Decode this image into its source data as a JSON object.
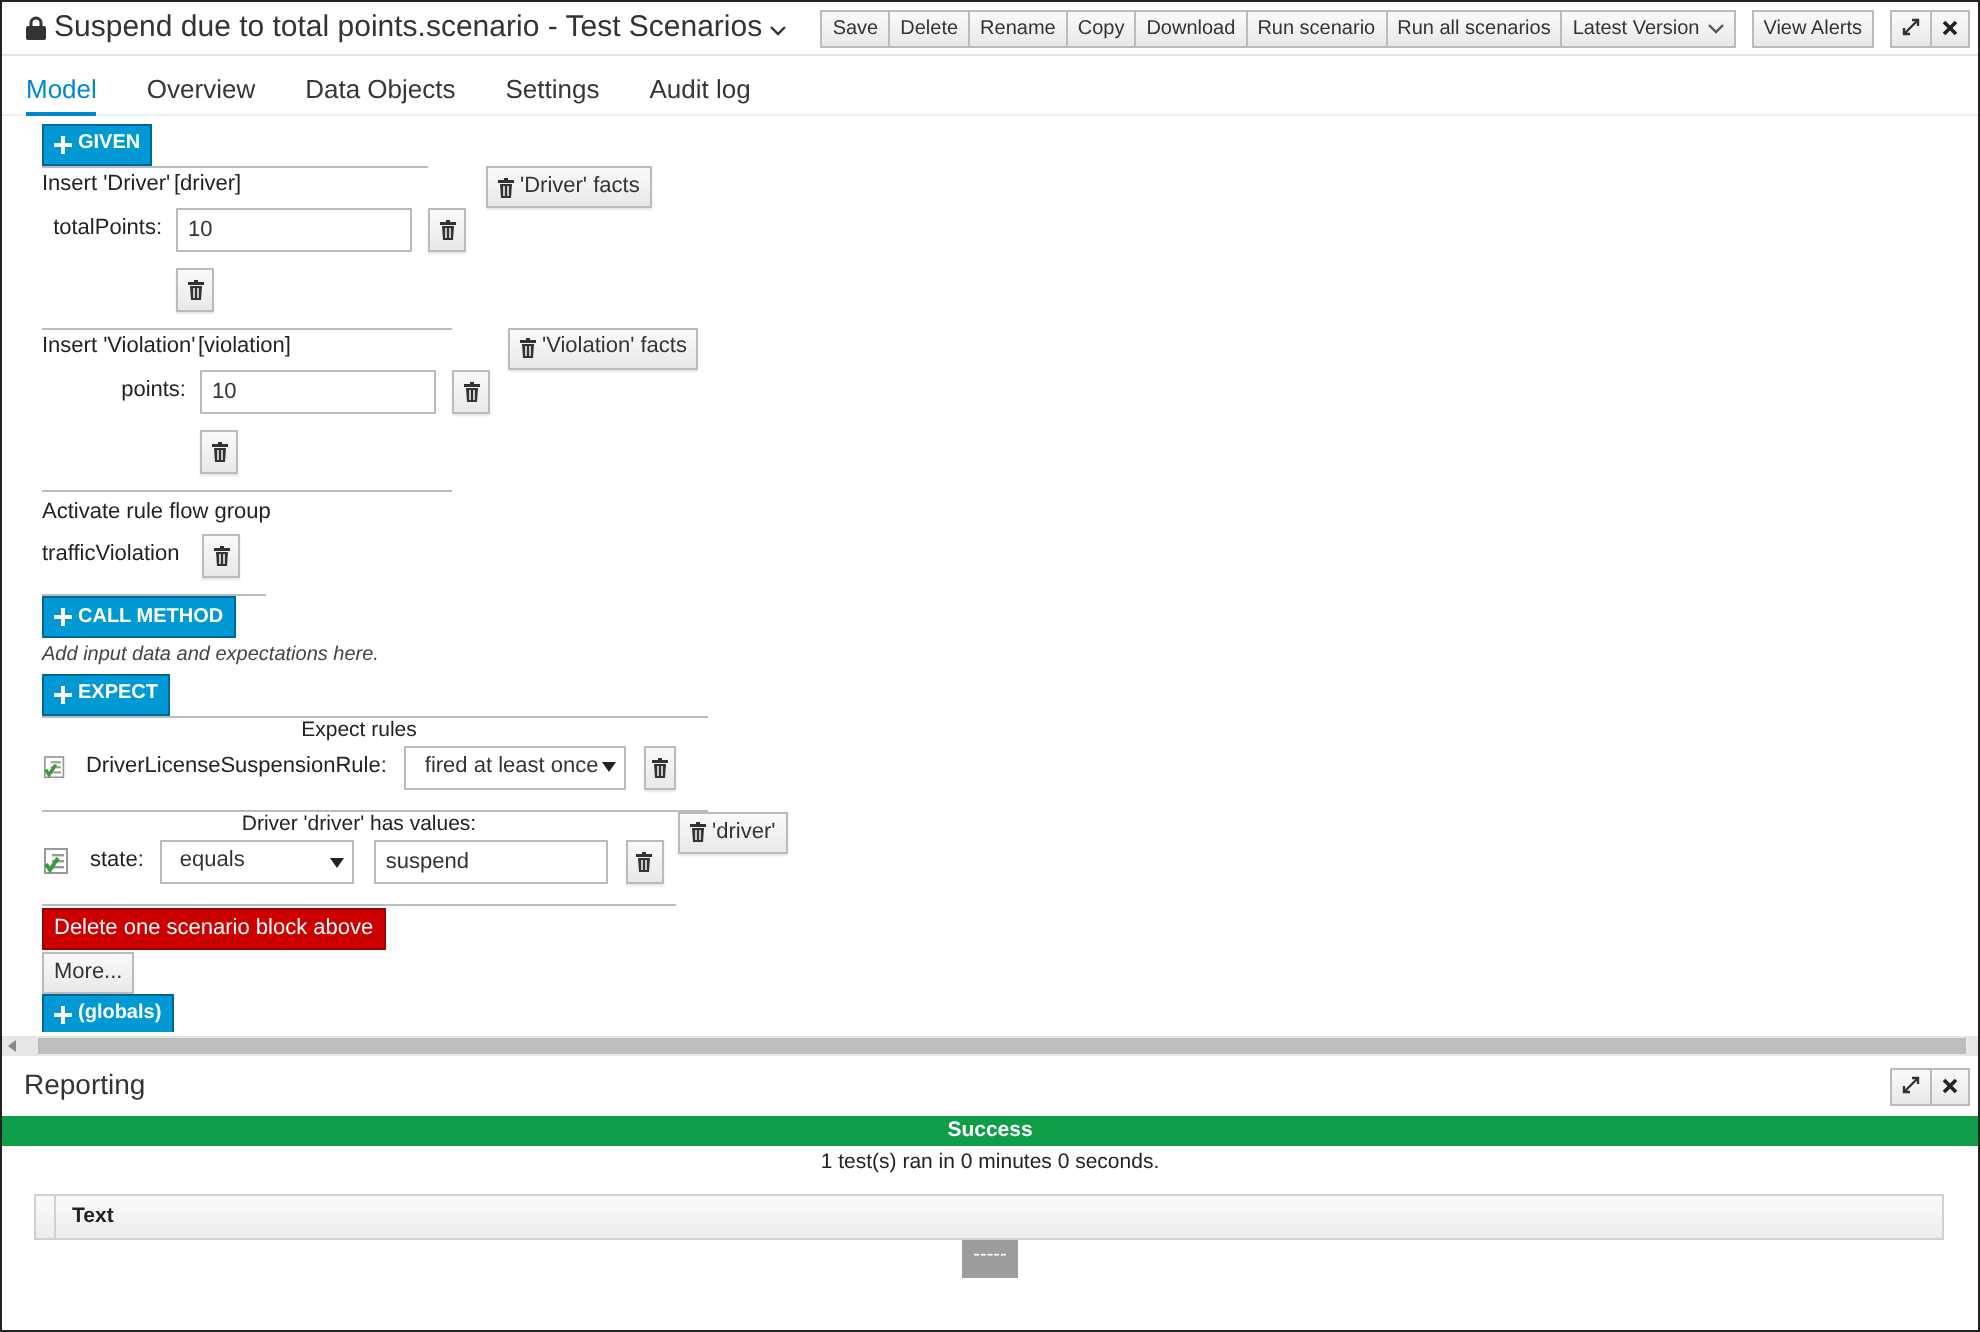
{
  "header": {
    "title": "Suspend due to total points.scenario - Test Scenarios",
    "locked": true
  },
  "toolbar": [
    {
      "label": "Save",
      "kind": "button"
    },
    {
      "label": "Delete",
      "kind": "button"
    },
    {
      "label": "Rename",
      "kind": "button"
    },
    {
      "label": "Copy",
      "kind": "button"
    },
    {
      "label": "Download",
      "kind": "button"
    },
    {
      "label": "Run scenario",
      "kind": "button"
    },
    {
      "label": "Run all scenarios",
      "kind": "button"
    },
    {
      "label": "Latest Version",
      "kind": "dropdown"
    }
  ],
  "alerts_button": "View Alerts",
  "tabs": [
    {
      "label": "Model",
      "selected": true
    },
    {
      "label": "Overview",
      "selected": false
    },
    {
      "label": "Data Objects",
      "selected": false
    },
    {
      "label": "Settings",
      "selected": false
    },
    {
      "label": "Audit log",
      "selected": false
    }
  ],
  "model": {
    "given_button": "GIVEN",
    "facts": [
      {
        "title": "Insert 'Driver'",
        "variable": "[driver]",
        "remove_button": "'Driver' facts",
        "fields": [
          {
            "label": "totalPoints:",
            "value": "10"
          }
        ]
      },
      {
        "title": "Insert 'Violation'",
        "variable": "[violation]",
        "remove_button": "'Violation' facts",
        "fields": [
          {
            "label": "points:",
            "value": "10"
          }
        ]
      }
    ],
    "rule_flow": {
      "title": "Activate rule flow group",
      "groups": [
        "trafficViolation"
      ]
    },
    "call_method_button": "CALL METHOD",
    "hint": "Add input data and expectations here.",
    "expect_button": "EXPECT",
    "expectations": [
      {
        "kind": "rules",
        "title": "Expect rules",
        "rows": [
          {
            "label": "DriverLicenseSuspensionRule:",
            "operator": "fired at least once"
          }
        ]
      },
      {
        "kind": "fact",
        "title": "Driver 'driver' has values:",
        "remove_button": "'driver'",
        "rows": [
          {
            "label": "state:",
            "operator": "equals",
            "value": "suspend"
          }
        ]
      }
    ],
    "delete_button": "Delete one scenario block above",
    "more_button": "More...",
    "globals_button": "(globals)"
  },
  "reporting": {
    "title": "Reporting",
    "status": {
      "label": "Success",
      "kind": "success"
    },
    "summary": "1 test(s) ran in 0 minutes 0 seconds.",
    "table": {
      "columns": [
        "Text"
      ]
    },
    "pager": "-----"
  }
}
